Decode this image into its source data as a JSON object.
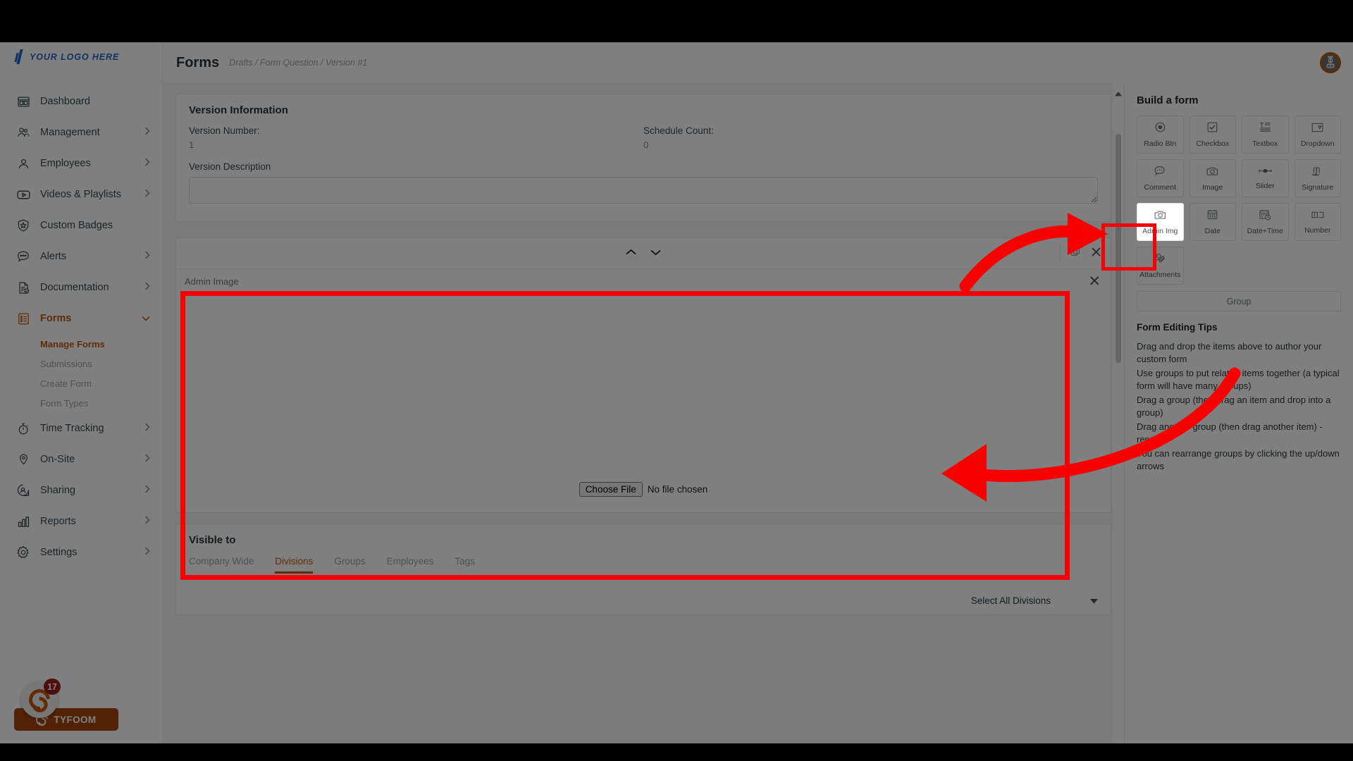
{
  "brand": {
    "logo_text": "YOUR LOGO HERE",
    "logo_color": "#1f66c9",
    "accent_color": "#c1560f",
    "annotation_color": "#f90000"
  },
  "sidebar": {
    "items": [
      {
        "label": "Dashboard",
        "icon": "dashboard-icon",
        "expandable": false,
        "active": false
      },
      {
        "label": "Management",
        "icon": "management-icon",
        "expandable": true,
        "active": false
      },
      {
        "label": "Employees",
        "icon": "employees-icon",
        "expandable": true,
        "active": false
      },
      {
        "label": "Videos & Playlists",
        "icon": "video-icon",
        "expandable": true,
        "active": false
      },
      {
        "label": "Custom Badges",
        "icon": "badge-icon",
        "expandable": false,
        "active": false
      },
      {
        "label": "Alerts",
        "icon": "alerts-icon",
        "expandable": true,
        "active": false
      },
      {
        "label": "Documentation",
        "icon": "document-icon",
        "expandable": true,
        "active": false
      },
      {
        "label": "Forms",
        "icon": "forms-icon",
        "expandable": true,
        "active": true
      },
      {
        "label": "Time Tracking",
        "icon": "stopwatch-icon",
        "expandable": true,
        "active": false
      },
      {
        "label": "On-Site",
        "icon": "location-pin-icon",
        "expandable": true,
        "active": false
      },
      {
        "label": "Sharing",
        "icon": "sharing-icon",
        "expandable": true,
        "active": false
      },
      {
        "label": "Reports",
        "icon": "bar-chart-icon",
        "expandable": true,
        "active": false
      },
      {
        "label": "Settings",
        "icon": "gear-icon",
        "expandable": true,
        "active": false
      }
    ],
    "forms_subitems": [
      {
        "label": "Manage Forms",
        "active": true
      },
      {
        "label": "Submissions",
        "active": false
      },
      {
        "label": "Create Form",
        "active": false
      },
      {
        "label": "Form Types",
        "active": false
      }
    ],
    "footer": {
      "app_name": "TYFOOM",
      "notification_count": "17"
    }
  },
  "header": {
    "title": "Forms",
    "breadcrumb": [
      "Drafts",
      "Form Question",
      "Version #1"
    ],
    "breadcrumb_text": "Drafts / Form Question / Version #1"
  },
  "version_card": {
    "title": "Version Information",
    "version_number_label": "Version Number:",
    "version_number_value": "1",
    "schedule_count_label": "Schedule Count:",
    "schedule_count_value": "0",
    "description_label": "Version Description",
    "description_value": "",
    "description_placeholder": ""
  },
  "widget_card": {
    "body_label": "Admin Image",
    "close_label": "✕",
    "file_button_label": "Choose File",
    "file_status_text": "No file chosen",
    "move_up_icon": "chevron-up-icon",
    "move_down_icon": "chevron-down-icon",
    "duplicate_icon": "copy-icon",
    "remove_icon": "close-icon"
  },
  "visible_to": {
    "title": "Visible to",
    "tabs": [
      {
        "label": "Company Wide",
        "active": false
      },
      {
        "label": "Divisions",
        "active": true
      },
      {
        "label": "Groups",
        "active": false
      },
      {
        "label": "Employees",
        "active": false
      },
      {
        "label": "Tags",
        "active": false
      }
    ],
    "select_all_label": "Select All Divisions"
  },
  "build_panel": {
    "title": "Build a form",
    "widgets": [
      {
        "label": "Radio Btn",
        "icon": "radio-button-icon",
        "highlighted": false
      },
      {
        "label": "Checkbox",
        "icon": "checkbox-icon",
        "highlighted": false
      },
      {
        "label": "Textbox",
        "icon": "textbox-icon",
        "highlighted": false
      },
      {
        "label": "Dropdown",
        "icon": "dropdown-icon",
        "highlighted": false
      },
      {
        "label": "Comment",
        "icon": "comment-icon",
        "highlighted": false
      },
      {
        "label": "Image",
        "icon": "camera-icon",
        "highlighted": false
      },
      {
        "label": "Slider",
        "icon": "slider-icon",
        "highlighted": false
      },
      {
        "label": "Signature",
        "icon": "signature-icon",
        "highlighted": false
      },
      {
        "label": "Admin Img",
        "icon": "camera-icon",
        "highlighted": true
      },
      {
        "label": "Date",
        "icon": "calendar-icon",
        "highlighted": false
      },
      {
        "label": "Date+Time",
        "icon": "calendar-clock-icon",
        "highlighted": false
      },
      {
        "label": "Number",
        "icon": "number-icon",
        "highlighted": false
      },
      {
        "label": "Attachments",
        "icon": "attachment-icon",
        "highlighted": false
      }
    ],
    "group_button_label": "Group",
    "tips_title": "Form Editing Tips",
    "tips": [
      "Drag and drop the items above to author your custom form",
      "Use groups to put related items together (a typical form will have many groups)",
      "Drag a group (then drag an item and drop into a group)",
      "Drag another group (then drag another item) - repeat",
      "You can rearrange groups by clicking the up/down arrows"
    ]
  }
}
